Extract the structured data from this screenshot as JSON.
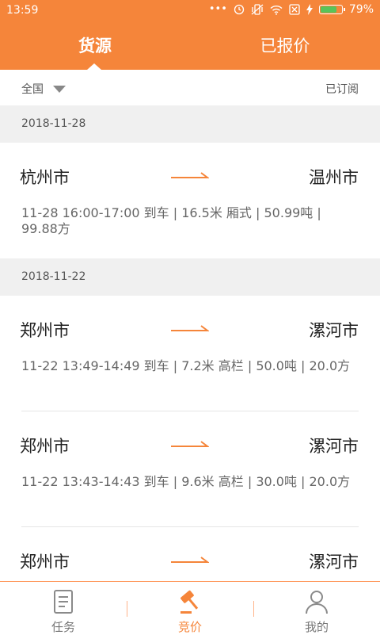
{
  "status_bar": {
    "time": "13:59",
    "battery_percent": "79%",
    "battery_level": 0.79,
    "icons": [
      "dots-icon",
      "alarm-icon",
      "vibrate-icon",
      "wifi-icon",
      "sim-icon",
      "charging-icon",
      "battery-icon"
    ]
  },
  "header": {
    "tabs": [
      {
        "label": "货源",
        "active": true
      },
      {
        "label": "已报价",
        "active": false
      }
    ]
  },
  "filter": {
    "region": "全国",
    "subscribed": "已订阅"
  },
  "groups": [
    {
      "date": "2018-11-28",
      "items": [
        {
          "from": "杭州市",
          "to": "温州市",
          "detail": "11-28 16:00-17:00 到车 | 16.5米 厢式 | 50.99吨 | 99.88方"
        }
      ]
    },
    {
      "date": "2018-11-22",
      "items": [
        {
          "from": "郑州市",
          "to": "漯河市",
          "detail": "11-22 13:49-14:49 到车 | 7.2米 高栏 | 50.0吨 | 20.0方"
        },
        {
          "from": "郑州市",
          "to": "漯河市",
          "detail": "11-22 13:43-14:43 到车 | 9.6米 高栏 | 30.0吨 | 20.0方"
        },
        {
          "from": "郑州市",
          "to": "漯河市",
          "detail": ""
        }
      ]
    }
  ],
  "bottom_nav": [
    {
      "label": "任务",
      "icon": "task-document-icon",
      "active": false
    },
    {
      "label": "竞价",
      "icon": "auction-hammer-icon",
      "active": true
    },
    {
      "label": "我的",
      "icon": "profile-person-icon",
      "active": false
    }
  ],
  "colors": {
    "accent": "#f5853a",
    "date_header_bg": "#f0f0f0"
  }
}
